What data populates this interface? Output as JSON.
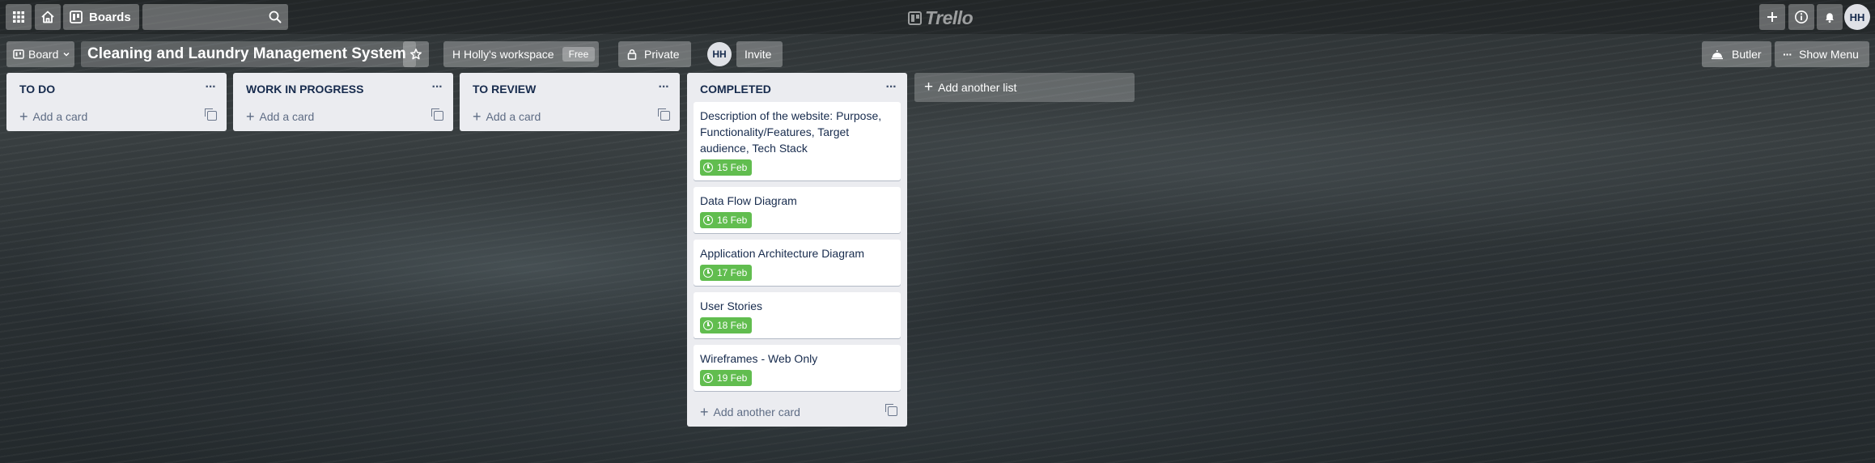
{
  "header": {
    "boards_label": "Boards",
    "search_placeholder": "",
    "logo_text": "Trello",
    "user_initials": "HH"
  },
  "board": {
    "view_label": "Board",
    "title": "Cleaning and Laundry Management System",
    "workspace_label": "H Holly's workspace",
    "workspace_plan": "Free",
    "visibility_label": "Private",
    "member_initials": "HH",
    "invite_label": "Invite",
    "butler_label": "Butler",
    "show_menu_label": "Show Menu",
    "add_list_label": "Add another list"
  },
  "lists": [
    {
      "title": "TO DO",
      "add_label": "Add a card",
      "cards": []
    },
    {
      "title": "WORK IN PROGRESS",
      "add_label": "Add a card",
      "cards": []
    },
    {
      "title": "TO REVIEW",
      "add_label": "Add a card",
      "cards": []
    },
    {
      "title": "COMPLETED",
      "add_label": "Add another card",
      "cards": [
        {
          "title": "Description of the website: Purpose, Functionality/Features, Target audience, Tech Stack",
          "due": "15 Feb"
        },
        {
          "title": "Data Flow Diagram",
          "due": "16 Feb"
        },
        {
          "title": "Application Architecture Diagram",
          "due": "17 Feb"
        },
        {
          "title": "User Stories",
          "due": "18 Feb"
        },
        {
          "title": "Wireframes - Web Only",
          "due": "19 Feb"
        }
      ]
    }
  ],
  "colors": {
    "due_complete": "#61bd4f",
    "list_bg": "#ebecf0",
    "text": "#172b4d"
  }
}
